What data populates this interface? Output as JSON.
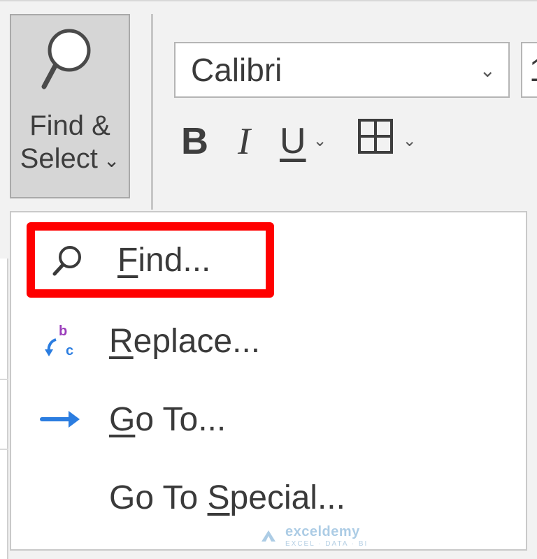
{
  "ribbon": {
    "find_select": {
      "line1": "Find &",
      "line2": "Select"
    },
    "font_name": "Calibri",
    "font_size_partial": "1",
    "bold_label": "B",
    "italic_label": "I",
    "underline_label": "U"
  },
  "menu": {
    "items": [
      {
        "key": "find",
        "label_pre": "",
        "label_u": "F",
        "label_post": "ind...",
        "highlighted": true
      },
      {
        "key": "replace",
        "label_pre": "",
        "label_u": "R",
        "label_post": "eplace..."
      },
      {
        "key": "goto",
        "label_pre": "",
        "label_u": "G",
        "label_post": "o To..."
      },
      {
        "key": "gotospecial",
        "label_pre": "Go To ",
        "label_u": "S",
        "label_post": "pecial..."
      }
    ]
  },
  "watermark": {
    "main": "exceldemy",
    "sub": "EXCEL · DATA · BI"
  }
}
